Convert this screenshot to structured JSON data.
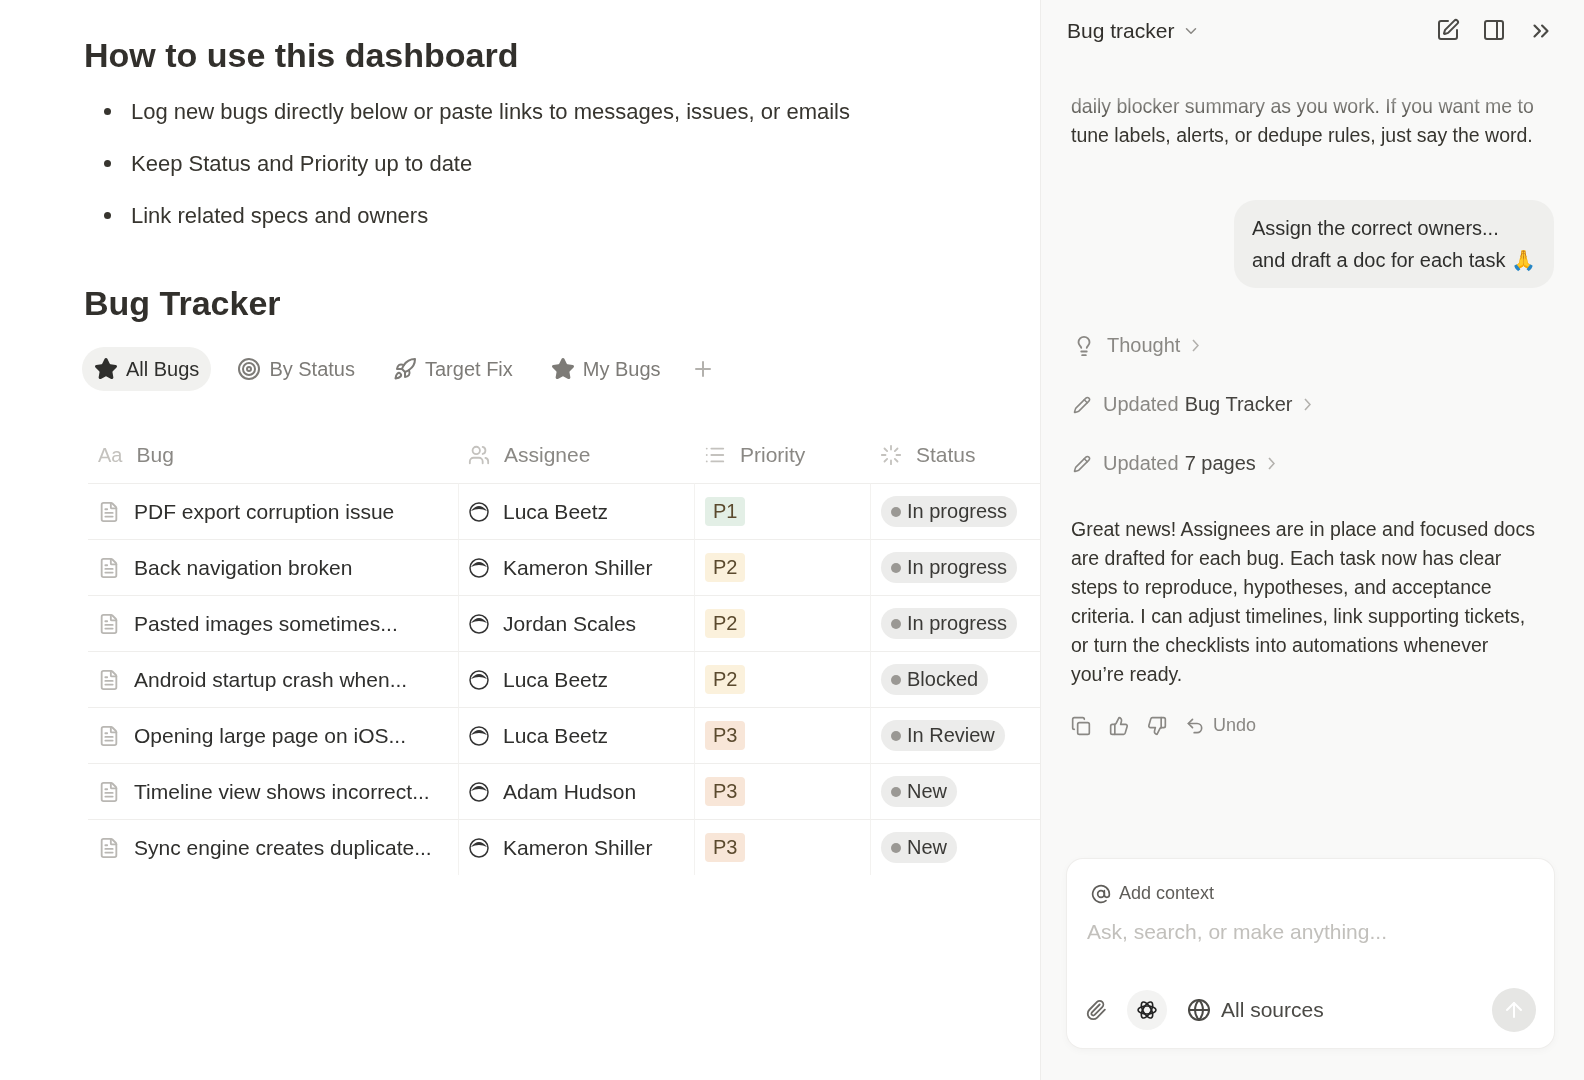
{
  "guide": {
    "title": "How to use this dashboard",
    "bullets": [
      "Log new bugs directly below or paste links to messages, issues, or emails",
      "Keep Status and Priority up to date",
      "Link related specs and owners"
    ]
  },
  "tracker": {
    "title": "Bug Tracker",
    "views": [
      {
        "label": "All Bugs",
        "selected": true
      },
      {
        "label": "By Status",
        "selected": false
      },
      {
        "label": "Target Fix",
        "selected": false
      },
      {
        "label": "My Bugs",
        "selected": false
      }
    ],
    "columns": [
      {
        "label": "Bug",
        "type_label": "Aa"
      },
      {
        "label": "Assignee"
      },
      {
        "label": "Priority"
      },
      {
        "label": "Status"
      }
    ],
    "rows": [
      {
        "bug": "PDF export corruption issue",
        "assignee": "Luca Beetz",
        "priority": {
          "label": "P1",
          "color": "#e3efe6"
        },
        "status": "In progress"
      },
      {
        "bug": "Back navigation broken",
        "assignee": "Kameron Shiller",
        "priority": {
          "label": "P2",
          "color": "#fbf1dc"
        },
        "status": "In progress"
      },
      {
        "bug": "Pasted images sometimes...",
        "assignee": "Jordan Scales",
        "priority": {
          "label": "P2",
          "color": "#fbf1dc"
        },
        "status": "In progress"
      },
      {
        "bug": "Android startup crash when...",
        "assignee": "Luca Beetz",
        "priority": {
          "label": "P2",
          "color": "#fbf1dc"
        },
        "status": "Blocked"
      },
      {
        "bug": "Opening large page on iOS...",
        "assignee": "Luca Beetz",
        "priority": {
          "label": "P3",
          "color": "#f8e6d8"
        },
        "status": "In Review"
      },
      {
        "bug": "Timeline view shows incorrect...",
        "assignee": "Adam Hudson",
        "priority": {
          "label": "P3",
          "color": "#f8e6d8"
        },
        "status": "New"
      },
      {
        "bug": "Sync engine creates duplicate...",
        "assignee": "Kameron Shiller",
        "priority": {
          "label": "P3",
          "color": "#f8e6d8"
        },
        "status": "New"
      }
    ]
  },
  "assistant": {
    "title": "Bug tracker",
    "earlier_message": "daily blocker summary as you work. If you want me to tune labels, alerts, or dedupe rules, just say the word.",
    "user_message": [
      "Assign the correct owners...",
      "and draft a doc for each task 🙏"
    ],
    "steps": [
      {
        "kind": "thought",
        "label": "Thought"
      },
      {
        "kind": "edit",
        "label": "Updated",
        "target": "Bug Tracker"
      },
      {
        "kind": "edit",
        "label": "Updated",
        "target": "7 pages"
      }
    ],
    "reply": "Great news! Assignees are in place and focused docs are drafted for each bug. Each task now has clear steps to reproduce, hypotheses, and acceptance criteria. I can adjust timelines, link supporting tickets, or turn the checklists into automations whenever you’re ready.",
    "undo": "Undo",
    "composer": {
      "context": "Add context",
      "placeholder": "Ask, search, or make anything...",
      "sources": "All sources"
    }
  }
}
